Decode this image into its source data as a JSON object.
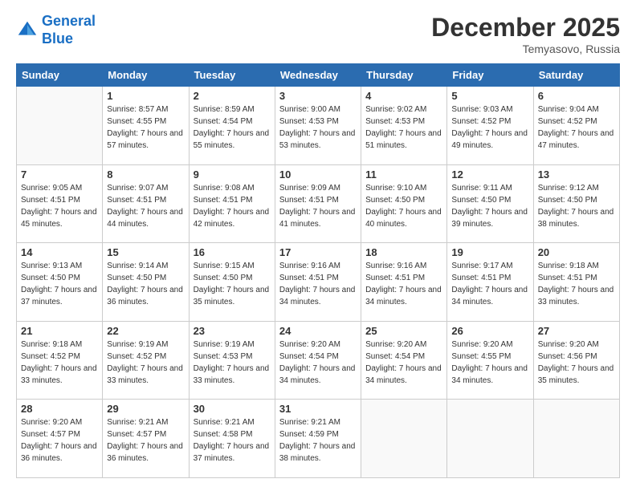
{
  "header": {
    "logo_line1": "General",
    "logo_line2": "Blue",
    "month": "December 2025",
    "location": "Temyasovo, Russia"
  },
  "weekdays": [
    "Sunday",
    "Monday",
    "Tuesday",
    "Wednesday",
    "Thursday",
    "Friday",
    "Saturday"
  ],
  "weeks": [
    [
      {
        "day": "",
        "sunrise": "",
        "sunset": "",
        "daylight": ""
      },
      {
        "day": "1",
        "sunrise": "Sunrise: 8:57 AM",
        "sunset": "Sunset: 4:55 PM",
        "daylight": "Daylight: 7 hours and 57 minutes."
      },
      {
        "day": "2",
        "sunrise": "Sunrise: 8:59 AM",
        "sunset": "Sunset: 4:54 PM",
        "daylight": "Daylight: 7 hours and 55 minutes."
      },
      {
        "day": "3",
        "sunrise": "Sunrise: 9:00 AM",
        "sunset": "Sunset: 4:53 PM",
        "daylight": "Daylight: 7 hours and 53 minutes."
      },
      {
        "day": "4",
        "sunrise": "Sunrise: 9:02 AM",
        "sunset": "Sunset: 4:53 PM",
        "daylight": "Daylight: 7 hours and 51 minutes."
      },
      {
        "day": "5",
        "sunrise": "Sunrise: 9:03 AM",
        "sunset": "Sunset: 4:52 PM",
        "daylight": "Daylight: 7 hours and 49 minutes."
      },
      {
        "day": "6",
        "sunrise": "Sunrise: 9:04 AM",
        "sunset": "Sunset: 4:52 PM",
        "daylight": "Daylight: 7 hours and 47 minutes."
      }
    ],
    [
      {
        "day": "7",
        "sunrise": "Sunrise: 9:05 AM",
        "sunset": "Sunset: 4:51 PM",
        "daylight": "Daylight: 7 hours and 45 minutes."
      },
      {
        "day": "8",
        "sunrise": "Sunrise: 9:07 AM",
        "sunset": "Sunset: 4:51 PM",
        "daylight": "Daylight: 7 hours and 44 minutes."
      },
      {
        "day": "9",
        "sunrise": "Sunrise: 9:08 AM",
        "sunset": "Sunset: 4:51 PM",
        "daylight": "Daylight: 7 hours and 42 minutes."
      },
      {
        "day": "10",
        "sunrise": "Sunrise: 9:09 AM",
        "sunset": "Sunset: 4:51 PM",
        "daylight": "Daylight: 7 hours and 41 minutes."
      },
      {
        "day": "11",
        "sunrise": "Sunrise: 9:10 AM",
        "sunset": "Sunset: 4:50 PM",
        "daylight": "Daylight: 7 hours and 40 minutes."
      },
      {
        "day": "12",
        "sunrise": "Sunrise: 9:11 AM",
        "sunset": "Sunset: 4:50 PM",
        "daylight": "Daylight: 7 hours and 39 minutes."
      },
      {
        "day": "13",
        "sunrise": "Sunrise: 9:12 AM",
        "sunset": "Sunset: 4:50 PM",
        "daylight": "Daylight: 7 hours and 38 minutes."
      }
    ],
    [
      {
        "day": "14",
        "sunrise": "Sunrise: 9:13 AM",
        "sunset": "Sunset: 4:50 PM",
        "daylight": "Daylight: 7 hours and 37 minutes."
      },
      {
        "day": "15",
        "sunrise": "Sunrise: 9:14 AM",
        "sunset": "Sunset: 4:50 PM",
        "daylight": "Daylight: 7 hours and 36 minutes."
      },
      {
        "day": "16",
        "sunrise": "Sunrise: 9:15 AM",
        "sunset": "Sunset: 4:50 PM",
        "daylight": "Daylight: 7 hours and 35 minutes."
      },
      {
        "day": "17",
        "sunrise": "Sunrise: 9:16 AM",
        "sunset": "Sunset: 4:51 PM",
        "daylight": "Daylight: 7 hours and 34 minutes."
      },
      {
        "day": "18",
        "sunrise": "Sunrise: 9:16 AM",
        "sunset": "Sunset: 4:51 PM",
        "daylight": "Daylight: 7 hours and 34 minutes."
      },
      {
        "day": "19",
        "sunrise": "Sunrise: 9:17 AM",
        "sunset": "Sunset: 4:51 PM",
        "daylight": "Daylight: 7 hours and 34 minutes."
      },
      {
        "day": "20",
        "sunrise": "Sunrise: 9:18 AM",
        "sunset": "Sunset: 4:51 PM",
        "daylight": "Daylight: 7 hours and 33 minutes."
      }
    ],
    [
      {
        "day": "21",
        "sunrise": "Sunrise: 9:18 AM",
        "sunset": "Sunset: 4:52 PM",
        "daylight": "Daylight: 7 hours and 33 minutes."
      },
      {
        "day": "22",
        "sunrise": "Sunrise: 9:19 AM",
        "sunset": "Sunset: 4:52 PM",
        "daylight": "Daylight: 7 hours and 33 minutes."
      },
      {
        "day": "23",
        "sunrise": "Sunrise: 9:19 AM",
        "sunset": "Sunset: 4:53 PM",
        "daylight": "Daylight: 7 hours and 33 minutes."
      },
      {
        "day": "24",
        "sunrise": "Sunrise: 9:20 AM",
        "sunset": "Sunset: 4:54 PM",
        "daylight": "Daylight: 7 hours and 34 minutes."
      },
      {
        "day": "25",
        "sunrise": "Sunrise: 9:20 AM",
        "sunset": "Sunset: 4:54 PM",
        "daylight": "Daylight: 7 hours and 34 minutes."
      },
      {
        "day": "26",
        "sunrise": "Sunrise: 9:20 AM",
        "sunset": "Sunset: 4:55 PM",
        "daylight": "Daylight: 7 hours and 34 minutes."
      },
      {
        "day": "27",
        "sunrise": "Sunrise: 9:20 AM",
        "sunset": "Sunset: 4:56 PM",
        "daylight": "Daylight: 7 hours and 35 minutes."
      }
    ],
    [
      {
        "day": "28",
        "sunrise": "Sunrise: 9:20 AM",
        "sunset": "Sunset: 4:57 PM",
        "daylight": "Daylight: 7 hours and 36 minutes."
      },
      {
        "day": "29",
        "sunrise": "Sunrise: 9:21 AM",
        "sunset": "Sunset: 4:57 PM",
        "daylight": "Daylight: 7 hours and 36 minutes."
      },
      {
        "day": "30",
        "sunrise": "Sunrise: 9:21 AM",
        "sunset": "Sunset: 4:58 PM",
        "daylight": "Daylight: 7 hours and 37 minutes."
      },
      {
        "day": "31",
        "sunrise": "Sunrise: 9:21 AM",
        "sunset": "Sunset: 4:59 PM",
        "daylight": "Daylight: 7 hours and 38 minutes."
      },
      {
        "day": "",
        "sunrise": "",
        "sunset": "",
        "daylight": ""
      },
      {
        "day": "",
        "sunrise": "",
        "sunset": "",
        "daylight": ""
      },
      {
        "day": "",
        "sunrise": "",
        "sunset": "",
        "daylight": ""
      }
    ]
  ]
}
